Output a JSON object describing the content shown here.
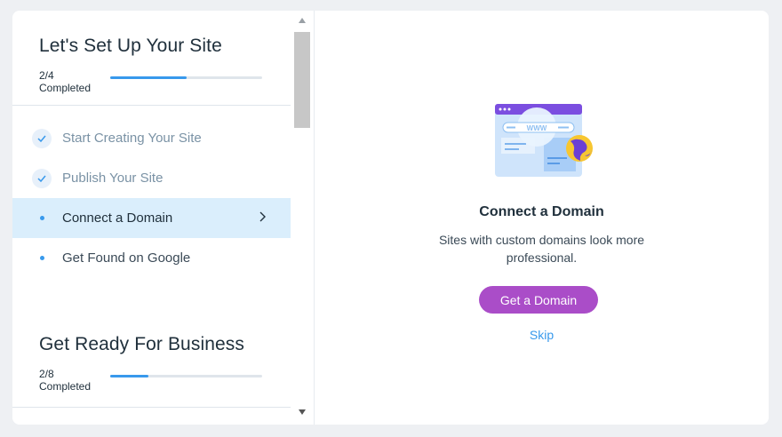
{
  "setup": {
    "title": "Let's Set Up Your Site",
    "progress_count": "2/4",
    "progress_label": "Completed",
    "progress_fraction": 0.5,
    "steps": [
      {
        "label": "Start Creating Your Site",
        "status": "done"
      },
      {
        "label": "Publish Your Site",
        "status": "done"
      },
      {
        "label": "Connect a Domain",
        "status": "active"
      },
      {
        "label": "Get Found on Google",
        "status": "todo"
      }
    ]
  },
  "business": {
    "title": "Get Ready For Business",
    "progress_count": "2/8",
    "progress_label": "Completed",
    "progress_fraction": 0.25
  },
  "detail": {
    "title": "Connect a Domain",
    "description": "Sites with custom domains look more professional.",
    "illustration_text": "WWW",
    "primary_button": "Get a Domain",
    "skip_label": "Skip"
  },
  "colors": {
    "accent": "#3899ec",
    "button": "#aa4dc8",
    "active_row": "#daeefc"
  }
}
